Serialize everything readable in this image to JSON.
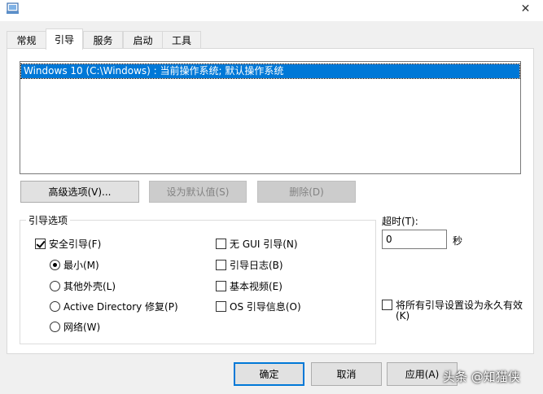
{
  "window": {
    "title": "",
    "close_glyph": "✕"
  },
  "tabs": [
    {
      "label": "常规"
    },
    {
      "label": "引导"
    },
    {
      "label": "服务"
    },
    {
      "label": "启动"
    },
    {
      "label": "工具"
    }
  ],
  "os_list": [
    {
      "label": "Windows 10 (C:\\Windows) : 当前操作系统; 默认操作系统",
      "selected": true
    }
  ],
  "buttons": {
    "advanced": "高级选项(V)...",
    "set_default": "设为默认值(S)",
    "delete": "删除(D)"
  },
  "boot_options": {
    "legend": "引导选项",
    "safe_boot": "安全引导(F)",
    "minimal": "最小(M)",
    "alternate_shell": "其他外壳(L)",
    "ad_repair": "Active Directory 修复(P)",
    "network": "网络(W)",
    "no_gui": "无 GUI 引导(N)",
    "boot_log": "引导日志(B)",
    "base_video": "基本视频(E)",
    "os_info": "OS 引导信息(O)"
  },
  "timeout": {
    "label": "超时(T):",
    "value": "0",
    "unit": "秒"
  },
  "permanent": {
    "line1": "将所有引导设置设为永久有效",
    "line2": "(K)"
  },
  "dialog_buttons": {
    "ok": "确定",
    "cancel": "取消",
    "apply": "应用(A)"
  },
  "watermark": "头条 @知猫侠",
  "colors": {
    "selection": "#0078d7",
    "default_button_border": "#0078d7"
  }
}
